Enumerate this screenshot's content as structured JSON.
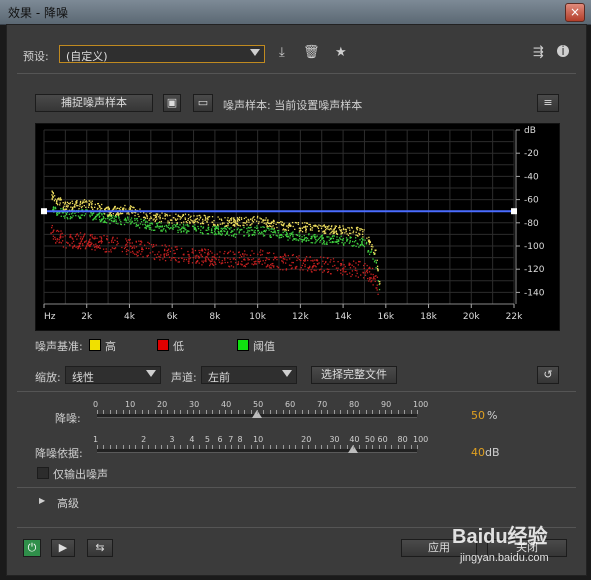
{
  "window": {
    "title": "效果 - 降噪",
    "close_glyph": "×"
  },
  "preset": {
    "label": "预设:",
    "value": "(自定义)"
  },
  "capture": {
    "button_label": "捕捉噪声样本",
    "sample_label": "噪声样本: 当前设置噪声样本"
  },
  "chart_data": {
    "type": "line",
    "x_ticks": [
      "Hz",
      "2k",
      "4k",
      "6k",
      "8k",
      "10k",
      "12k",
      "14k",
      "16k",
      "18k",
      "20k",
      "22k"
    ],
    "y_ticks": [
      "dB",
      "-20",
      "-40",
      "-60",
      "-80",
      "-100",
      "-120",
      "-140"
    ],
    "xlim_hz": [
      0,
      22000
    ],
    "ylim_db": [
      0,
      -150
    ],
    "threshold_curve_db": -70,
    "series": [
      {
        "name": "高",
        "color": "#f0e060",
        "x_khz": [
          0.3,
          1,
          2,
          3,
          4,
          5,
          6,
          7,
          8,
          9,
          10,
          11,
          12,
          13,
          14,
          15,
          15.5,
          15.7
        ],
        "y_db": [
          -55,
          -66,
          -62,
          -70,
          -68,
          -74,
          -76,
          -76,
          -78,
          -79,
          -77,
          -82,
          -83,
          -85,
          -86,
          -88,
          -105,
          -135
        ]
      },
      {
        "name": "低",
        "color": "#c82020",
        "x_khz": [
          0.3,
          1,
          2,
          3,
          4,
          5,
          6,
          7,
          8,
          9,
          10,
          11,
          12,
          13,
          14,
          15,
          15.5,
          15.7
        ],
        "y_db": [
          -88,
          -95,
          -95,
          -98,
          -100,
          -104,
          -106,
          -108,
          -110,
          -111,
          -109,
          -113,
          -114,
          -116,
          -118,
          -120,
          -128,
          -140
        ]
      },
      {
        "name": "阈值",
        "color": "#40d040",
        "x_khz": [
          0.3,
          1,
          2,
          3,
          4,
          5,
          6,
          7,
          8,
          9,
          10,
          11,
          12,
          13,
          14,
          15,
          15.5,
          15.7
        ],
        "y_db": [
          -68,
          -72,
          -72,
          -76,
          -78,
          -82,
          -84,
          -85,
          -86,
          -88,
          -86,
          -90,
          -92,
          -94,
          -95,
          -97,
          -112,
          -138
        ]
      }
    ]
  },
  "legend": {
    "label": "噪声基准:",
    "high": "高",
    "low": "低",
    "threshold": "阈值",
    "colors": {
      "high": "#f0e000",
      "low": "#e00000",
      "threshold": "#10e010"
    }
  },
  "controls": {
    "scale_label": "缩放:",
    "scale_value": "线性",
    "channel_label": "声道:",
    "channel_value": "左前",
    "select_file_button": "选择完整文件"
  },
  "reduction": {
    "label": "降噪:",
    "scale": [
      "0",
      "10",
      "20",
      "30",
      "40",
      "50",
      "60",
      "70",
      "80",
      "90",
      "100"
    ],
    "value": "50",
    "unit": "%",
    "fraction": 0.5
  },
  "reduce_by": {
    "label": "降噪依据:",
    "scale": [
      "1",
      "2",
      "3",
      "4",
      "5",
      "6",
      "7",
      "8",
      "10",
      "20",
      "30",
      "40",
      "50",
      "60",
      "80",
      "100"
    ],
    "value": "40",
    "unit": "dB",
    "fraction": 0.8
  },
  "output_noise_only": {
    "label": "仅输出噪声"
  },
  "advanced": {
    "label": "高级",
    "arrow": "▶"
  },
  "footer": {
    "apply_button": "应用",
    "close_button": "关闭"
  },
  "watermark": {
    "text": "Baidu经验",
    "url": "jingyan.baidu.com"
  }
}
